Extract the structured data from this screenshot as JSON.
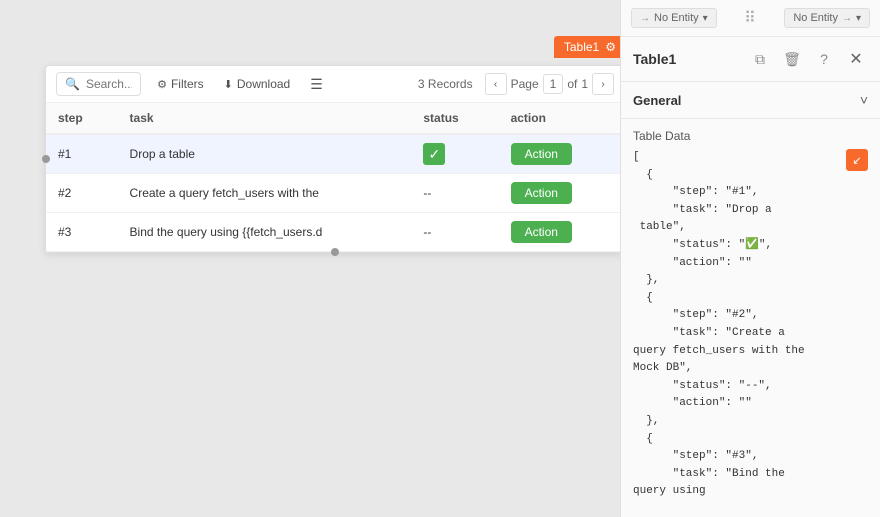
{
  "canvas": {
    "background": "#e8e8e8"
  },
  "widget": {
    "label": "Table1",
    "gear": "⚙"
  },
  "toolbar": {
    "search_placeholder": "Search...",
    "filters_label": "Filters",
    "download_label": "Download",
    "records_label": "3 Records",
    "page_label": "Page",
    "page_current": "1",
    "page_total": "1"
  },
  "table": {
    "columns": [
      "step",
      "task",
      "status",
      "action"
    ],
    "rows": [
      {
        "step": "#1",
        "task": "Drop a table",
        "status": "check",
        "action": "Action"
      },
      {
        "step": "#2",
        "task": "Create a query fetch_users with the",
        "status": "dash",
        "action": "Action"
      },
      {
        "step": "#3",
        "task": "Bind the query using {{fetch_users.d",
        "status": "dash",
        "action": "Action"
      }
    ]
  },
  "right_panel": {
    "left_entity": "No Entity",
    "right_entity": "No Entity",
    "title": "Table1",
    "general_label": "General",
    "table_data_label": "Table Data",
    "json_content": "[\n  {\n      \"step\": \"#1\",\n      \"task\": \"Drop a\n table\",\n      \"status\": \"✅\",\n      \"action\": \"\"\n  },\n  {\n      \"step\": \"#2\",\n      \"task\": \"Create a\nquery fetch_users with the\nMock DB\",\n      \"status\": \"--\",\n      \"action\": \"\"\n  },\n  {\n      \"step\": \"#3\",\n      \"task\": \"Bind the\nquery using",
    "copy_icon": "⬇",
    "duplicate_icon": "⧉",
    "delete_icon": "🗑",
    "help_icon": "?",
    "close_icon": "✕",
    "chevron_down": "˅"
  }
}
